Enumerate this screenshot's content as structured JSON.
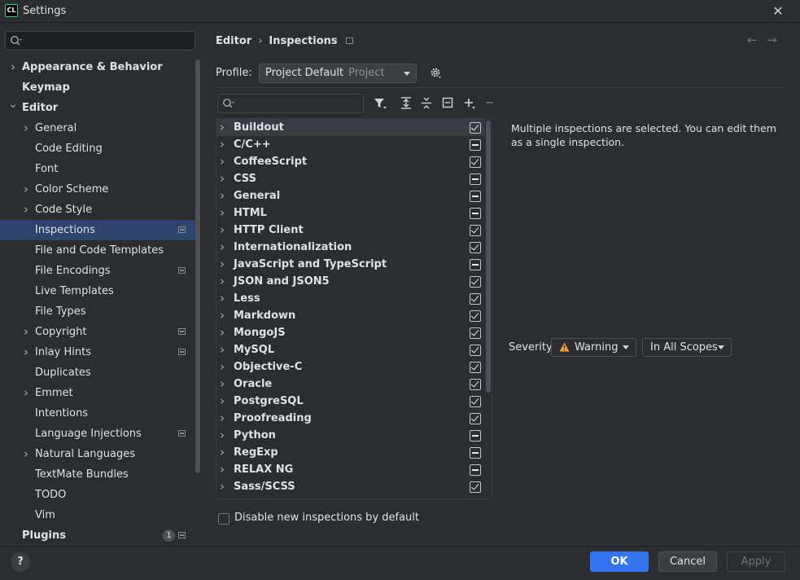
{
  "window": {
    "title": "Settings",
    "app_icon": "CL"
  },
  "sidebar": {
    "items": [
      {
        "label": "Appearance & Behavior",
        "level": 0,
        "bold": true,
        "chevron": "right"
      },
      {
        "label": "Keymap",
        "level": 0,
        "bold": true,
        "chevron": ""
      },
      {
        "label": "Editor",
        "level": 0,
        "bold": true,
        "chevron": "down"
      },
      {
        "label": "General",
        "level": 1,
        "chevron": "right"
      },
      {
        "label": "Code Editing",
        "level": 1,
        "chevron": ""
      },
      {
        "label": "Font",
        "level": 1,
        "chevron": ""
      },
      {
        "label": "Color Scheme",
        "level": 1,
        "chevron": "right"
      },
      {
        "label": "Code Style",
        "level": 1,
        "chevron": "right"
      },
      {
        "label": "Inspections",
        "level": 1,
        "chevron": "",
        "selected": true,
        "badge": true
      },
      {
        "label": "File and Code Templates",
        "level": 1,
        "chevron": ""
      },
      {
        "label": "File Encodings",
        "level": 1,
        "chevron": "",
        "badge": true
      },
      {
        "label": "Live Templates",
        "level": 1,
        "chevron": ""
      },
      {
        "label": "File Types",
        "level": 1,
        "chevron": ""
      },
      {
        "label": "Copyright",
        "level": 1,
        "chevron": "right",
        "badge": true
      },
      {
        "label": "Inlay Hints",
        "level": 1,
        "chevron": "right",
        "badge": true
      },
      {
        "label": "Duplicates",
        "level": 1,
        "chevron": ""
      },
      {
        "label": "Emmet",
        "level": 1,
        "chevron": "right"
      },
      {
        "label": "Intentions",
        "level": 1,
        "chevron": ""
      },
      {
        "label": "Language Injections",
        "level": 1,
        "chevron": "",
        "badge": true
      },
      {
        "label": "Natural Languages",
        "level": 1,
        "chevron": "right"
      },
      {
        "label": "TextMate Bundles",
        "level": 1,
        "chevron": ""
      },
      {
        "label": "TODO",
        "level": 1,
        "chevron": ""
      },
      {
        "label": "Vim",
        "level": 1,
        "chevron": ""
      },
      {
        "label": "Plugins",
        "level": 0,
        "bold": true,
        "chevron": "",
        "badge": true,
        "count": "1"
      }
    ]
  },
  "breadcrumb": {
    "parent": "Editor",
    "separator": "›",
    "current": "Inspections"
  },
  "profile": {
    "label": "Profile:",
    "value": "Project Default",
    "sub": "Project"
  },
  "inspections": {
    "rows": [
      {
        "label": "Buildout",
        "state": "checked",
        "selected": true
      },
      {
        "label": "C/C++",
        "state": "mixed"
      },
      {
        "label": "CoffeeScript",
        "state": "checked"
      },
      {
        "label": "CSS",
        "state": "mixed"
      },
      {
        "label": "General",
        "state": "mixed"
      },
      {
        "label": "HTML",
        "state": "mixed"
      },
      {
        "label": "HTTP Client",
        "state": "checked"
      },
      {
        "label": "Internationalization",
        "state": "checked"
      },
      {
        "label": "JavaScript and TypeScript",
        "state": "mixed"
      },
      {
        "label": "JSON and JSON5",
        "state": "checked"
      },
      {
        "label": "Less",
        "state": "checked"
      },
      {
        "label": "Markdown",
        "state": "checked"
      },
      {
        "label": "MongoJS",
        "state": "checked"
      },
      {
        "label": "MySQL",
        "state": "checked"
      },
      {
        "label": "Objective-C",
        "state": "checked"
      },
      {
        "label": "Oracle",
        "state": "checked"
      },
      {
        "label": "PostgreSQL",
        "state": "checked"
      },
      {
        "label": "Proofreading",
        "state": "checked"
      },
      {
        "label": "Python",
        "state": "mixed"
      },
      {
        "label": "RegExp",
        "state": "mixed"
      },
      {
        "label": "RELAX NG",
        "state": "mixed"
      },
      {
        "label": "Sass/SCSS",
        "state": "checked"
      }
    ]
  },
  "details": {
    "info": "Multiple inspections are selected. You can edit them as a single inspection.",
    "severity_label": "Severity:",
    "severity_value": "Warning",
    "scope_value": "In All Scopes"
  },
  "disable_new": {
    "label": "Disable new inspections by default"
  },
  "footer": {
    "help": "?",
    "ok": "OK",
    "cancel": "Cancel",
    "apply": "Apply"
  },
  "colors": {
    "accent": "#3574f0",
    "selection": "#2e436e",
    "background": "#2b2d30",
    "warning": "#f2a433"
  }
}
